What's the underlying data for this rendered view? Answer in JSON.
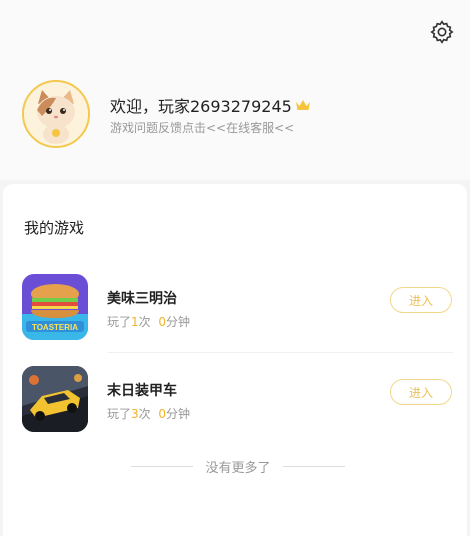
{
  "profile": {
    "welcome_text": "欢迎，玩家2693279245",
    "feedback_text": "游戏问题反馈点击<<在线客服<<",
    "settings_icon": "gear-icon",
    "badge_icon": "crown-icon"
  },
  "games_section": {
    "title": "我的游戏",
    "games": [
      {
        "name": "美味三明治",
        "stats": {
          "prefix": "玩了",
          "count": "1",
          "unit": "次",
          "minutes": "0",
          "minutes_unit": "分钟"
        },
        "enter_label": "进入",
        "icon": "sandwich-icon"
      },
      {
        "name": "末日装甲车",
        "stats": {
          "prefix": "玩了",
          "count": "3",
          "unit": "次",
          "minutes": "0",
          "minutes_unit": "分钟"
        },
        "enter_label": "进入",
        "icon": "armored-car-icon"
      }
    ],
    "no_more_text": "没有更多了"
  },
  "colors": {
    "accent": "#f0b32a",
    "button_border": "#f3d88a",
    "muted_text": "#999999"
  }
}
